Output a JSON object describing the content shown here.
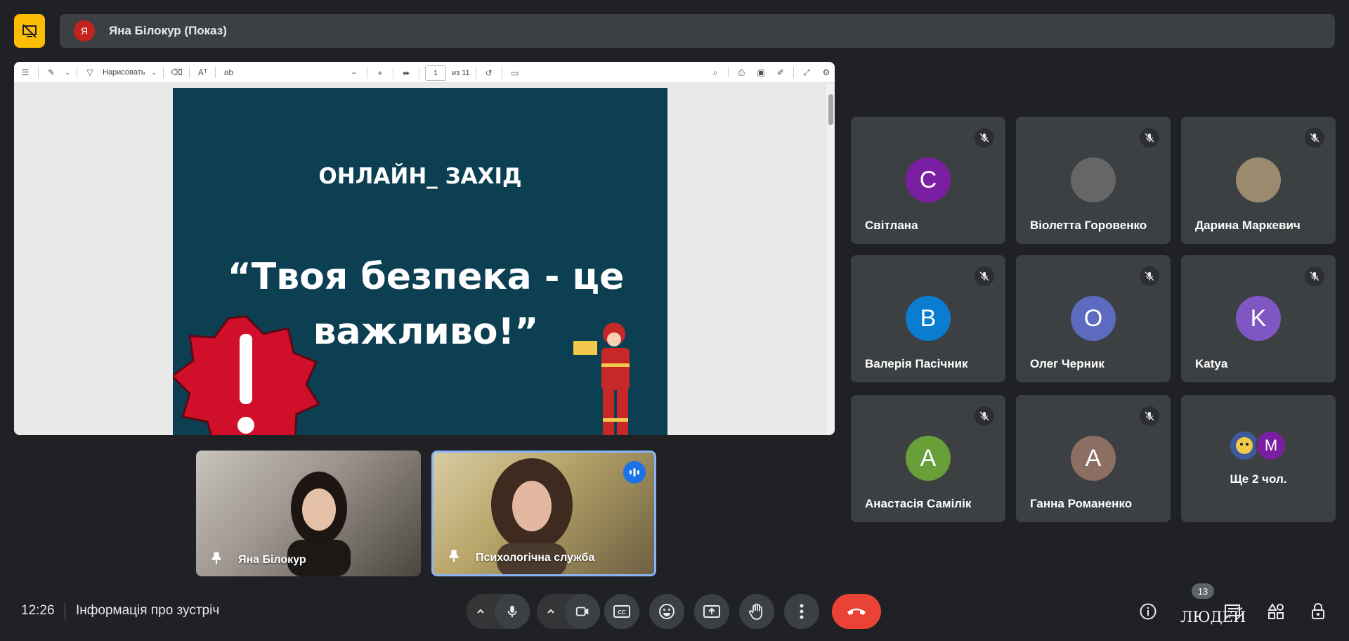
{
  "header": {
    "presenter_avatar_letter": "Я",
    "presentation_title": "Яна Білокур (Показ)"
  },
  "pdf_viewer": {
    "draw_label": "Нарисовать",
    "page_current": "1",
    "page_total": "из 11"
  },
  "slide": {
    "kicker": "ОНЛАЙН_ ЗАХІД",
    "title": "“Твоя безпека - це важливо!”"
  },
  "self_tiles": [
    {
      "name": "Яна Білокур"
    },
    {
      "name": "Психологічна служба"
    }
  ],
  "participants": [
    {
      "name": "Світлана",
      "initial": "С",
      "color": "#7b1fa2"
    },
    {
      "name": "Віолетта Горовенко",
      "initial": "",
      "color": "#666666"
    },
    {
      "name": "Дарина Маркевич",
      "initial": "",
      "color": "#9a8a6e"
    },
    {
      "name": "Валерія Пасічник",
      "initial": "В",
      "color": "#0b7dd0"
    },
    {
      "name": "Олег Черник",
      "initial": "О",
      "color": "#5c6bc0"
    },
    {
      "name": "Katya",
      "initial": "K",
      "color": "#7e57c2"
    },
    {
      "name": "Анастасія Самілік",
      "initial": "А",
      "color": "#689f38"
    },
    {
      "name": "Ганна Романенко",
      "initial": "А",
      "color": "#8d6e63"
    }
  ],
  "more_participants": {
    "label": "Ще 2 чол.",
    "avatar_letter": "M",
    "avatar_color": "#7b1fa2"
  },
  "bottom_bar": {
    "time": "12:26",
    "meeting_info": "Інформація про зустріч",
    "people_count": "13",
    "people_label": "ЛЮДЕЙ"
  },
  "colors": {
    "end_call": "#ea4335",
    "active_speaker": "#1a73e8"
  }
}
